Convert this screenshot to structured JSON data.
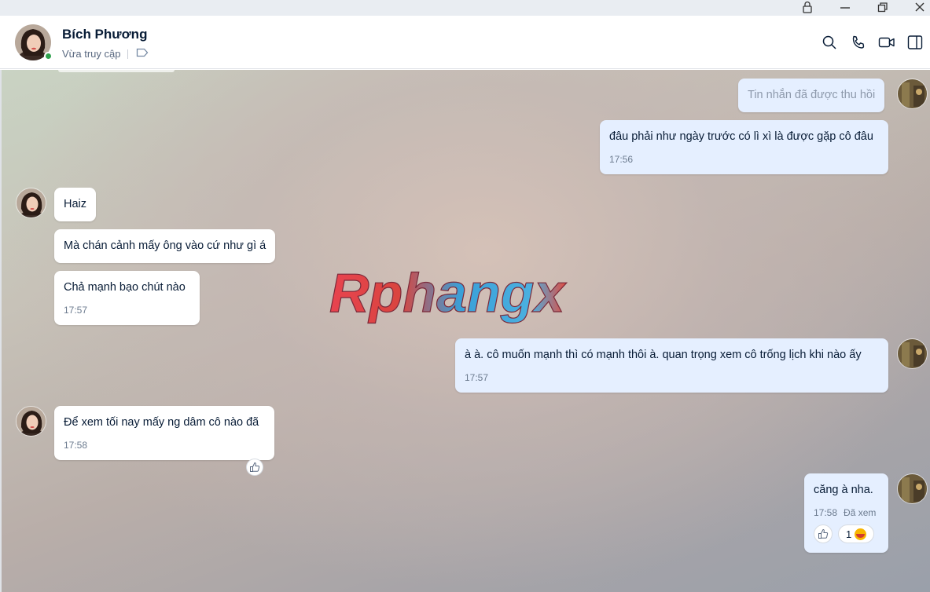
{
  "window": {
    "lock_icon": "lock-icon",
    "minimize_icon": "minimize-icon",
    "restore_icon": "restore-icon",
    "close_icon": "close-icon"
  },
  "header": {
    "contact_name": "Bích Phương",
    "status": "Vừa truy cập",
    "online": true,
    "online_color": "#30a24e",
    "icons": [
      "search-icon",
      "phone-icon",
      "video-icon",
      "sidebar-toggle-icon"
    ]
  },
  "watermark": {
    "text": "Rphangx"
  },
  "messages": [
    {
      "from": "me",
      "text": "Tin nhắn đã được thu hồi",
      "recalled": true
    },
    {
      "from": "me",
      "text": "đâu phải như ngày trước có lì xì là được gặp cô đâu",
      "time": "17:56"
    },
    {
      "from": "them",
      "text": "Haiz"
    },
    {
      "from": "them",
      "text": "Mà chán cảnh mấy ông vào cứ như gì á"
    },
    {
      "from": "them",
      "text": "Chả mạnh bạo chút nào",
      "time": "17:57"
    },
    {
      "from": "me",
      "text": "à à. cô muốn mạnh thì có mạnh thôi à. quan trọng xem cô trống lịch khi nào ấy",
      "time": "17:57"
    },
    {
      "from": "them",
      "text": "Để xem tối nay mấy ng dâm cô nào đã",
      "time": "17:58"
    },
    {
      "from": "me",
      "text": "căng à nha.",
      "time": "17:58",
      "seen": "Đã xem",
      "reaction_count": "1"
    }
  ],
  "colors": {
    "outgoing_bubble": "#e5efff",
    "incoming_bubble": "#ffffff"
  }
}
